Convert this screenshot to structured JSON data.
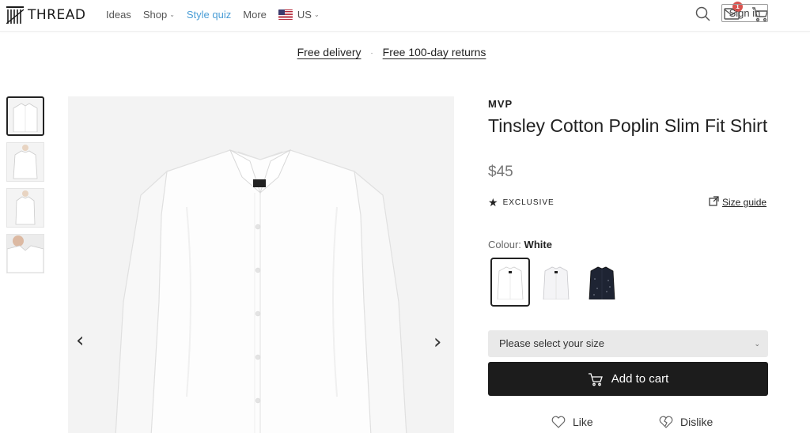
{
  "header": {
    "logo_text": "THREAD",
    "nav": [
      {
        "label": "Ideas"
      },
      {
        "label": "Shop"
      },
      {
        "label": "Style quiz"
      },
      {
        "label": "More"
      }
    ],
    "region": "US",
    "cart_badge": "1",
    "sign_in": "Sign in"
  },
  "promo": {
    "delivery": "Free delivery",
    "separator": "·",
    "returns": "Free 100-day returns"
  },
  "product": {
    "brand": "MVP",
    "title": "Tinsley Cotton Poplin Slim Fit Shirt",
    "price": "$45",
    "exclusive_label": "EXCLUSIVE",
    "size_guide": "Size guide",
    "colour_label": "Colour:",
    "colour_value": "White",
    "size_placeholder": "Please select your size",
    "add_to_cart": "Add to cart",
    "like": "Like",
    "dislike": "Dislike"
  },
  "colors": {
    "accent": "#4a9dd6",
    "badge": "#d9534f",
    "button_bg": "#1c1c1c",
    "select_bg": "#e9e9e9"
  },
  "icons": [
    "search-icon",
    "mail-icon",
    "cart-icon",
    "star-icon",
    "external-link-icon",
    "heart-icon",
    "broken-heart-icon",
    "chevron-left-icon",
    "chevron-right-icon"
  ]
}
